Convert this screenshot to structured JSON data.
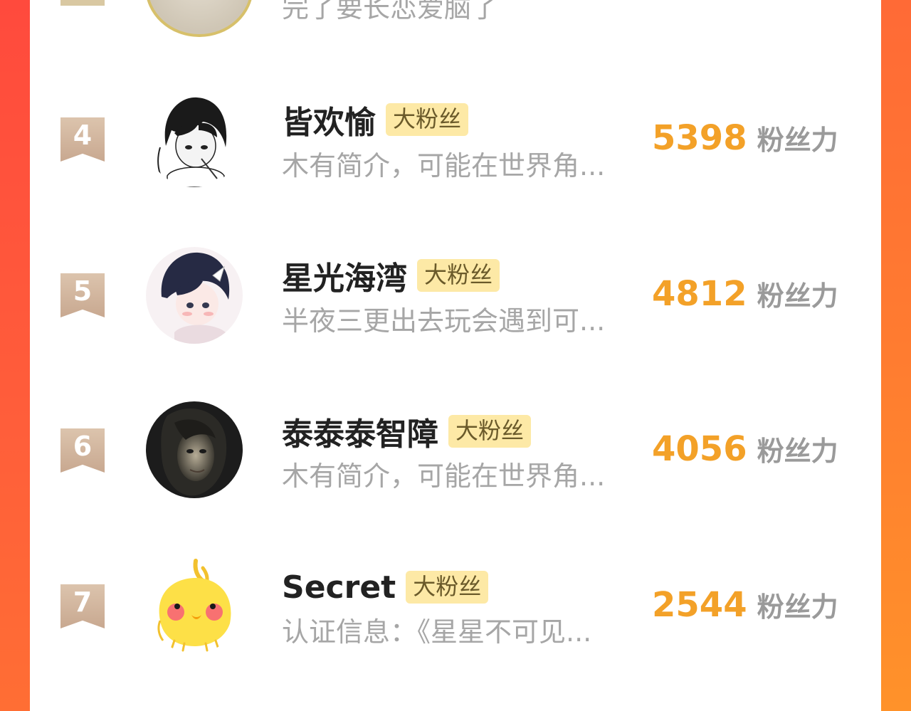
{
  "colors": {
    "accent_orange": "#ff6e34",
    "score_color": "#f3a128",
    "badge_bg": "#fde9a6",
    "flag_color": "#c8a890"
  },
  "partial_row": {
    "bio": "完了要长恋爱脑了"
  },
  "score_unit": "粉丝力",
  "badge_label": "大粉丝",
  "rows": [
    {
      "rank": "4",
      "name": "皆欢愉",
      "bio": "木有简介，可能在世界角...",
      "score": "5398",
      "avatar_icon": "anime-girl-avatar"
    },
    {
      "rank": "5",
      "name": "星光海湾",
      "bio": "半夜三更出去玩会遇到可...",
      "score": "4812",
      "avatar_icon": "anime-boy-avatar"
    },
    {
      "rank": "6",
      "name": "泰泰泰智障",
      "bio": "木有简介，可能在世界角...",
      "score": "4056",
      "avatar_icon": "dark-portrait-avatar"
    },
    {
      "rank": "7",
      "name": "Secret",
      "bio": "认证信息：《星星不可见...",
      "score": "2544",
      "avatar_icon": "yellow-bird-avatar"
    }
  ]
}
